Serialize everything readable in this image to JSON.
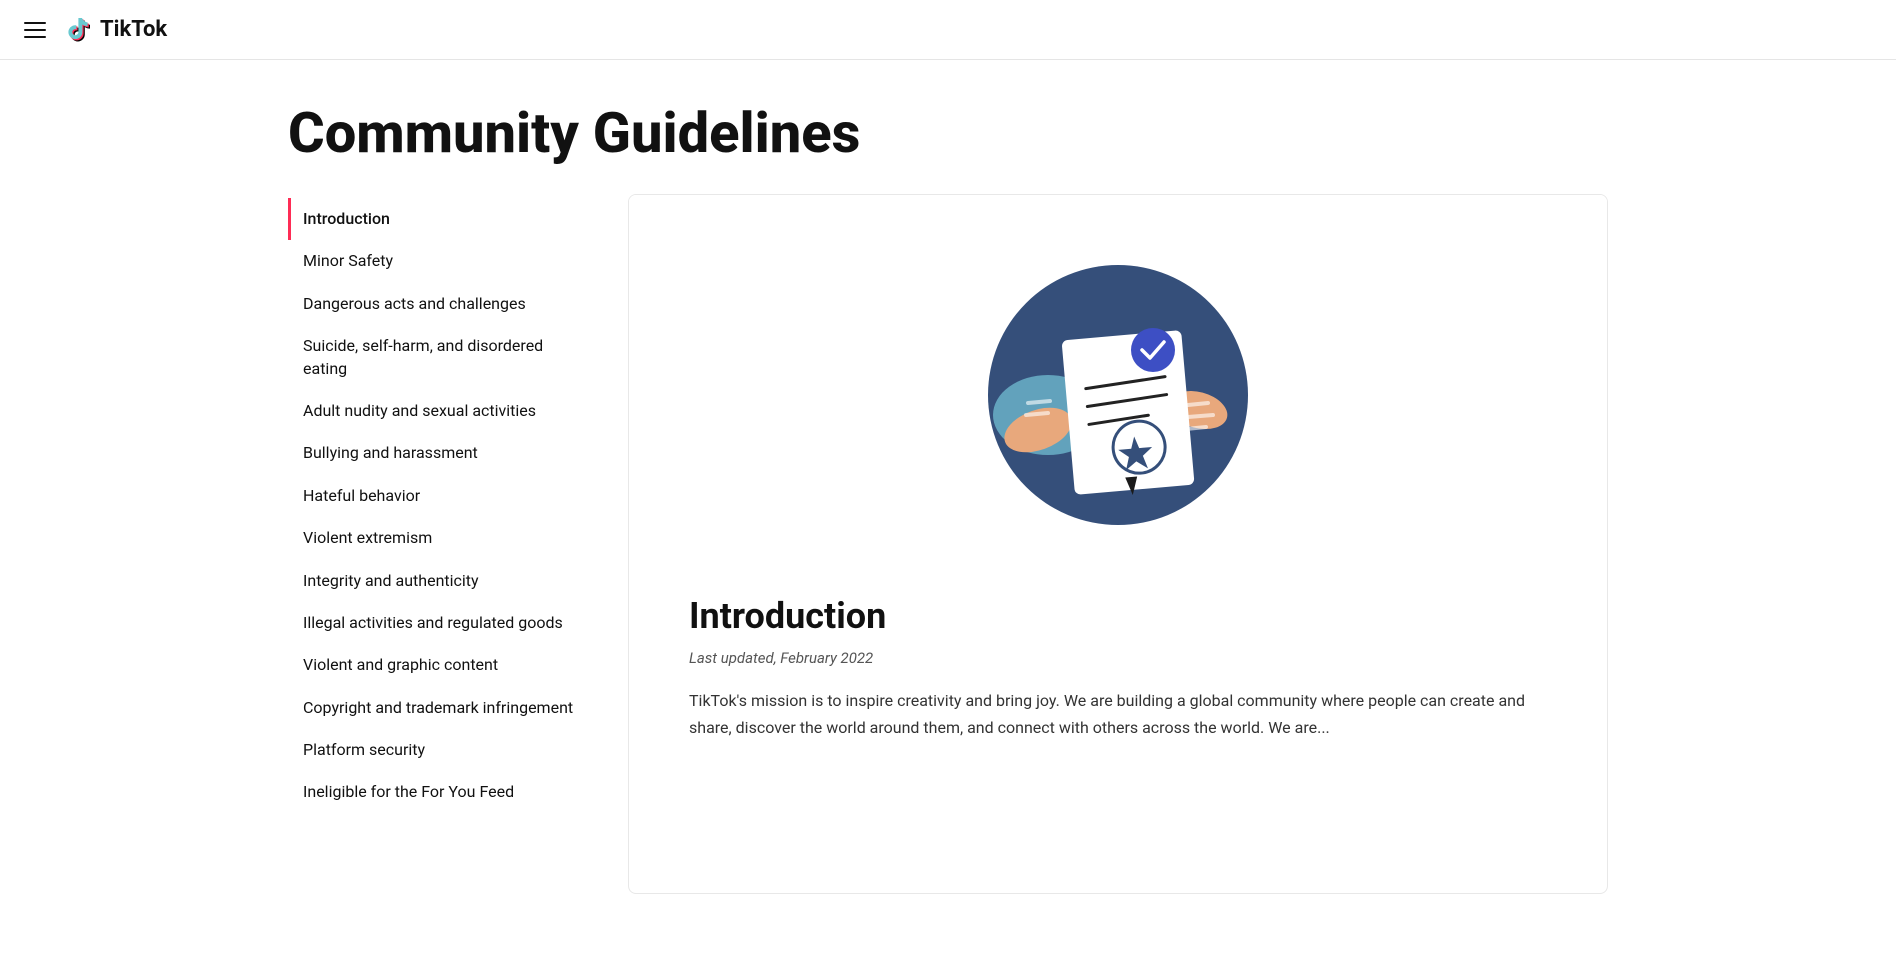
{
  "header": {
    "logo_text": "TikTok",
    "menu_icon_label": "menu"
  },
  "page": {
    "title": "Community Guidelines"
  },
  "sidebar": {
    "items": [
      {
        "id": "introduction",
        "label": "Introduction",
        "active": true
      },
      {
        "id": "minor-safety",
        "label": "Minor Safety",
        "active": false
      },
      {
        "id": "dangerous-acts",
        "label": "Dangerous acts and challenges",
        "active": false
      },
      {
        "id": "suicide-self-harm",
        "label": "Suicide, self-harm, and disordered eating",
        "active": false
      },
      {
        "id": "adult-nudity",
        "label": "Adult nudity and sexual activities",
        "active": false
      },
      {
        "id": "bullying",
        "label": "Bullying and harassment",
        "active": false
      },
      {
        "id": "hateful",
        "label": "Hateful behavior",
        "active": false
      },
      {
        "id": "violent-extremism",
        "label": "Violent extremism",
        "active": false
      },
      {
        "id": "integrity",
        "label": "Integrity and authenticity",
        "active": false
      },
      {
        "id": "illegal-activities",
        "label": "Illegal activities and regulated goods",
        "active": false
      },
      {
        "id": "violent-graphic",
        "label": "Violent and graphic content",
        "active": false
      },
      {
        "id": "copyright",
        "label": "Copyright and trademark infringement",
        "active": false
      },
      {
        "id": "platform-security",
        "label": "Platform security",
        "active": false
      },
      {
        "id": "ineligible",
        "label": "Ineligible for the For You Feed",
        "active": false
      }
    ]
  },
  "main": {
    "section_title": "Introduction",
    "last_updated": "Last updated, February 2022",
    "body_text": "TikTok's mission is to inspire creativity and bring joy. We are building a global community where people can create and share, discover the world around them, and connect with others across the world. We are..."
  },
  "colors": {
    "active_border": "#fe2c55",
    "tiktok_red": "#fe2c55",
    "illustration_dark_blue": "#354f7a",
    "illustration_mid_blue": "#4a6fa5",
    "illustration_light_blue": "#6ab0c8",
    "illustration_skin": "#e8a87c",
    "illustration_check_blue": "#3d4fc4",
    "illustration_star_outline": "#354f7a"
  }
}
